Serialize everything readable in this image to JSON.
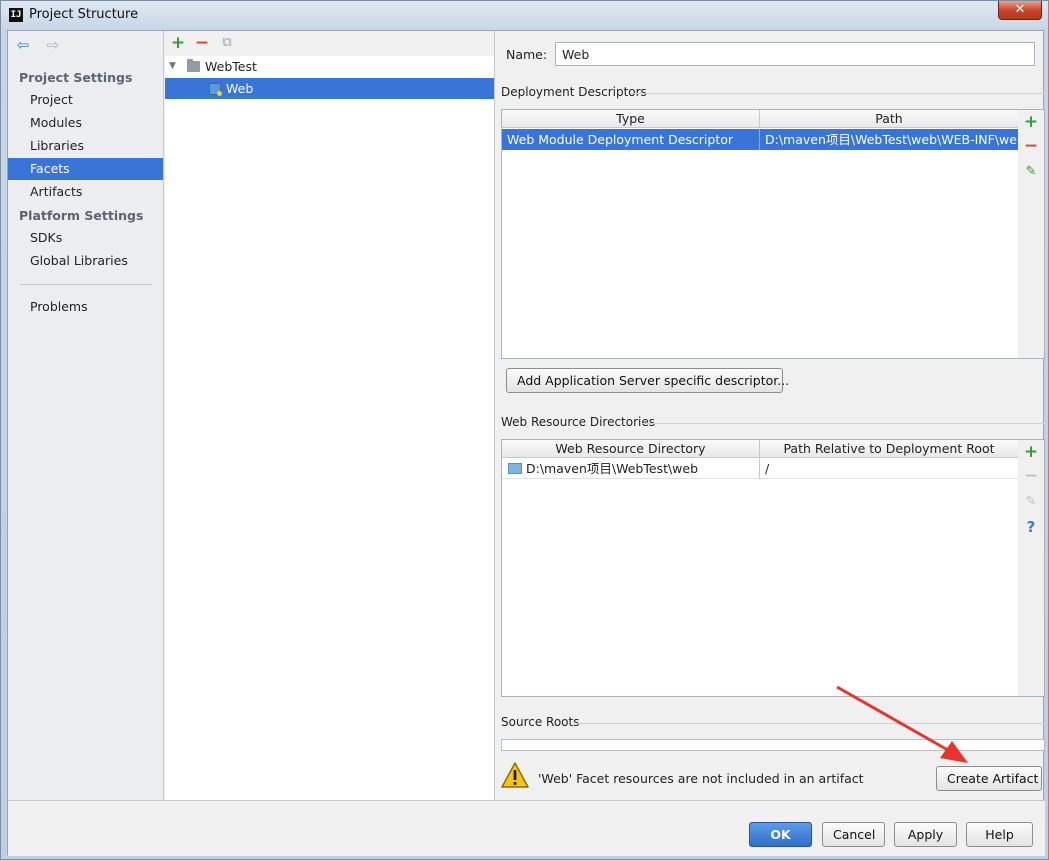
{
  "window": {
    "title": "Project Structure",
    "close_glyph": "✕",
    "app_icon_text": "IJ"
  },
  "nav": {
    "back_glyph": "⇦",
    "forward_glyph": "⇨",
    "project_settings_header": "Project Settings",
    "project_items": [
      "Project",
      "Modules",
      "Libraries",
      "Facets",
      "Artifacts"
    ],
    "platform_settings_header": "Platform Settings",
    "platform_items": [
      "SDKs",
      "Global Libraries"
    ],
    "problems": "Problems",
    "selected": "Facets"
  },
  "tree": {
    "toolbar": {
      "add": "+",
      "remove": "−",
      "copy": "⧉"
    },
    "root": {
      "label": "WebTest",
      "toggle": "▼"
    },
    "child": {
      "label": "Web"
    }
  },
  "facet": {
    "name_label": "Name:",
    "name_value": "Web",
    "deployment": {
      "title": "Deployment Descriptors",
      "columns": [
        "Type",
        "Path"
      ],
      "rows": [
        {
          "type": "Web Module Deployment Descriptor",
          "path": "D:\\maven项目\\WebTest\\web\\WEB-INF\\web."
        }
      ],
      "add_server_button": "Add Application Server specific descriptor..."
    },
    "resources": {
      "title": "Web Resource Directories",
      "columns": [
        "Web Resource Directory",
        "Path Relative to Deployment Root"
      ],
      "rows": [
        {
          "directory": "D:\\maven项目\\WebTest\\web",
          "relative": "/"
        }
      ]
    },
    "source_roots": {
      "title": "Source Roots"
    },
    "warning": {
      "text": "'Web' Facet resources are not included in an artifact",
      "button": "Create Artifact"
    },
    "side_tools": {
      "add": "+",
      "remove": "−",
      "edit": "✎",
      "help": "?"
    }
  },
  "buttons": {
    "ok": "OK",
    "cancel": "Cancel",
    "apply": "Apply",
    "help": "Help"
  },
  "colors": {
    "selection": "#3875d7",
    "add": "#3a9b3a",
    "remove": "#d4473b",
    "annotation_arrow": "#e8342e"
  }
}
